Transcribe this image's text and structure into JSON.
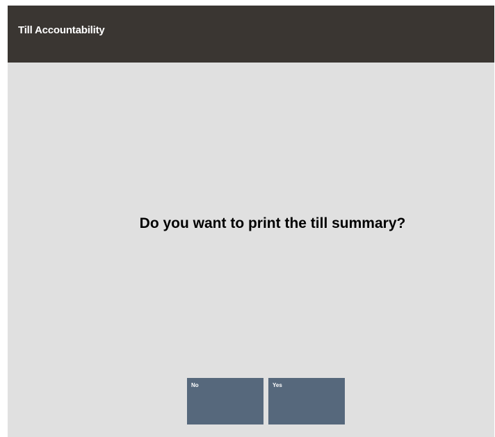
{
  "header": {
    "title": "Till Accountability"
  },
  "dialog": {
    "prompt": "Do you want to print the till summary?"
  },
  "buttons": {
    "no_label": "No",
    "yes_label": "Yes"
  },
  "colors": {
    "header_background": "#3a3632",
    "content_background": "#e0e0e0",
    "button_background": "#56687c",
    "header_text": "#ffffff",
    "prompt_text": "#000000"
  }
}
